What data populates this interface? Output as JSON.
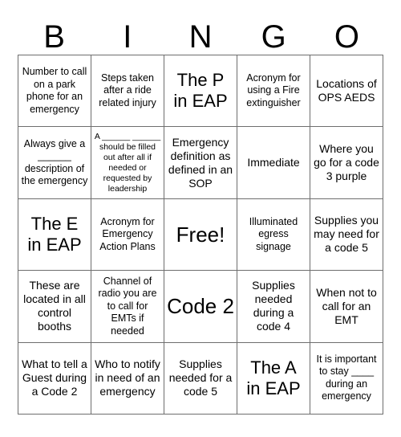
{
  "header": {
    "letters": [
      "B",
      "I",
      "N",
      "G",
      "O"
    ]
  },
  "grid": {
    "rows": 5,
    "columns": 5,
    "border_color": "#6e6e6e",
    "background_color": "#ffffff",
    "text_color": "#000000",
    "cells": [
      {
        "text": "Number to call on a park phone for an emergency",
        "size": "s"
      },
      {
        "text": "Steps taken after a ride related injury",
        "size": "s"
      },
      {
        "text": "The P\nin EAP",
        "size": "l"
      },
      {
        "text": "Acronym for using a Fire extinguisher",
        "size": "s"
      },
      {
        "text": "Locations of OPS AEDS",
        "size": "m"
      },
      {
        "text": "Always give a ______ description of the emergency",
        "size": "s"
      },
      {
        "text": "A ______ ______ should be filled out after all if needed or requested by leadership",
        "size": "xs"
      },
      {
        "text": "Emergency definition as defined in an SOP",
        "size": "m"
      },
      {
        "text": "Immediate",
        "size": "m"
      },
      {
        "text": "Where you go for a code 3 purple",
        "size": "m"
      },
      {
        "text": "The E\nin EAP",
        "size": "l"
      },
      {
        "text": "Acronym for Emergency Action Plans",
        "size": "s"
      },
      {
        "text": "Free!",
        "size": "xl"
      },
      {
        "text": "Illuminated egress signage",
        "size": "s"
      },
      {
        "text": "Supplies you may need for a code 5",
        "size": "m"
      },
      {
        "text": "These are located in all control booths",
        "size": "m"
      },
      {
        "text": "Channel of radio you are to call for EMTs if needed",
        "size": "s"
      },
      {
        "text": "Code 2",
        "size": "xl"
      },
      {
        "text": "Supplies needed during a code 4",
        "size": "m"
      },
      {
        "text": "When not to call for an EMT",
        "size": "m"
      },
      {
        "text": "What to tell a Guest during a Code 2",
        "size": "m"
      },
      {
        "text": "Who to notify in need of an emergency",
        "size": "m"
      },
      {
        "text": "Supplies needed for a code 5",
        "size": "m"
      },
      {
        "text": "The A\nin EAP",
        "size": "l"
      },
      {
        "text": "It is important to stay ____ during an emergency",
        "size": "s"
      }
    ]
  }
}
